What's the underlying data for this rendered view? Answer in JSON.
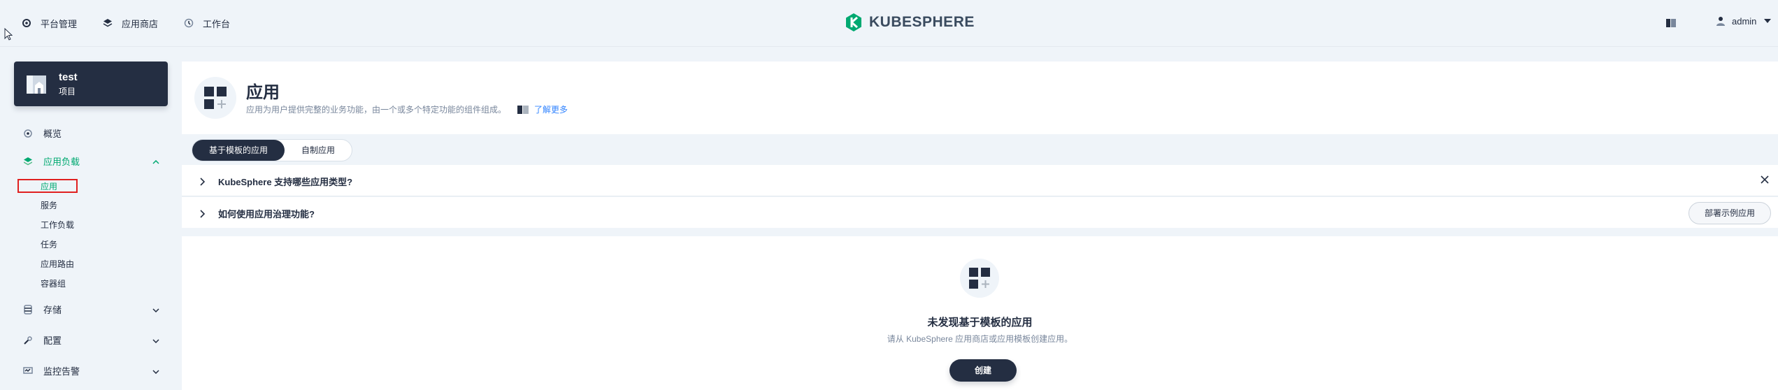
{
  "topnav": {
    "items": [
      {
        "label": "平台管理",
        "icon": "gear-icon"
      },
      {
        "label": "应用商店",
        "icon": "appstore-icon"
      },
      {
        "label": "工作台",
        "icon": "dashboard-icon"
      }
    ],
    "logo_text": "KUBESPHERE",
    "user": "admin"
  },
  "sidebar": {
    "project_name": "test",
    "project_type": "项目",
    "items": [
      {
        "label": "概览"
      },
      {
        "label": "应用负载"
      },
      {
        "label": "存储"
      },
      {
        "label": "配置"
      },
      {
        "label": "监控告警"
      }
    ],
    "workload_sub": [
      "应用",
      "服务",
      "工作负载",
      "任务",
      "应用路由",
      "容器组"
    ]
  },
  "banner": {
    "title": "应用",
    "description": "应用为用户提供完整的业务功能，由一个或多个特定功能的组件组成。",
    "learn_more": "了解更多"
  },
  "tabs": [
    "基于模板的应用",
    "自制应用"
  ],
  "faq": {
    "q1": "KubeSphere 支持哪些应用类型?",
    "q2": "如何使用应用治理功能?",
    "deploy_button": "部署示例应用"
  },
  "empty": {
    "title": "未发现基于模板的应用",
    "description": "请从 KubeSphere 应用商店或应用模板创建应用。",
    "create_button": "创建"
  },
  "colors": {
    "dark": "#242e42",
    "background": "#eff4f9",
    "link": "#3385ff",
    "logo_green": "#00a971",
    "highlight_box": "#e02020"
  }
}
